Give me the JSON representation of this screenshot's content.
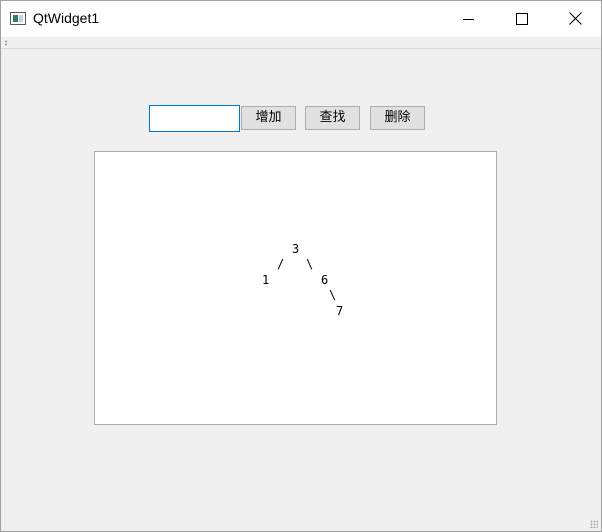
{
  "window": {
    "title": "QtWidget1",
    "icons": {
      "app": "app-window-icon",
      "minimize": "minimize-icon",
      "maximize": "maximize-icon",
      "close": "close-icon"
    }
  },
  "toolbar": {
    "input_value": "",
    "add_label": "增加",
    "find_label": "查找",
    "delete_label": "删除"
  },
  "tree": {
    "root": "3",
    "left": "1",
    "right": "6",
    "right_right": "7",
    "edge_left": "/",
    "edge_right": "\\",
    "edge_right_right": "\\"
  },
  "colors": {
    "focus_border": "#0078d7",
    "button_bg": "#e1e1e1",
    "window_bg": "#f0f0f0"
  }
}
